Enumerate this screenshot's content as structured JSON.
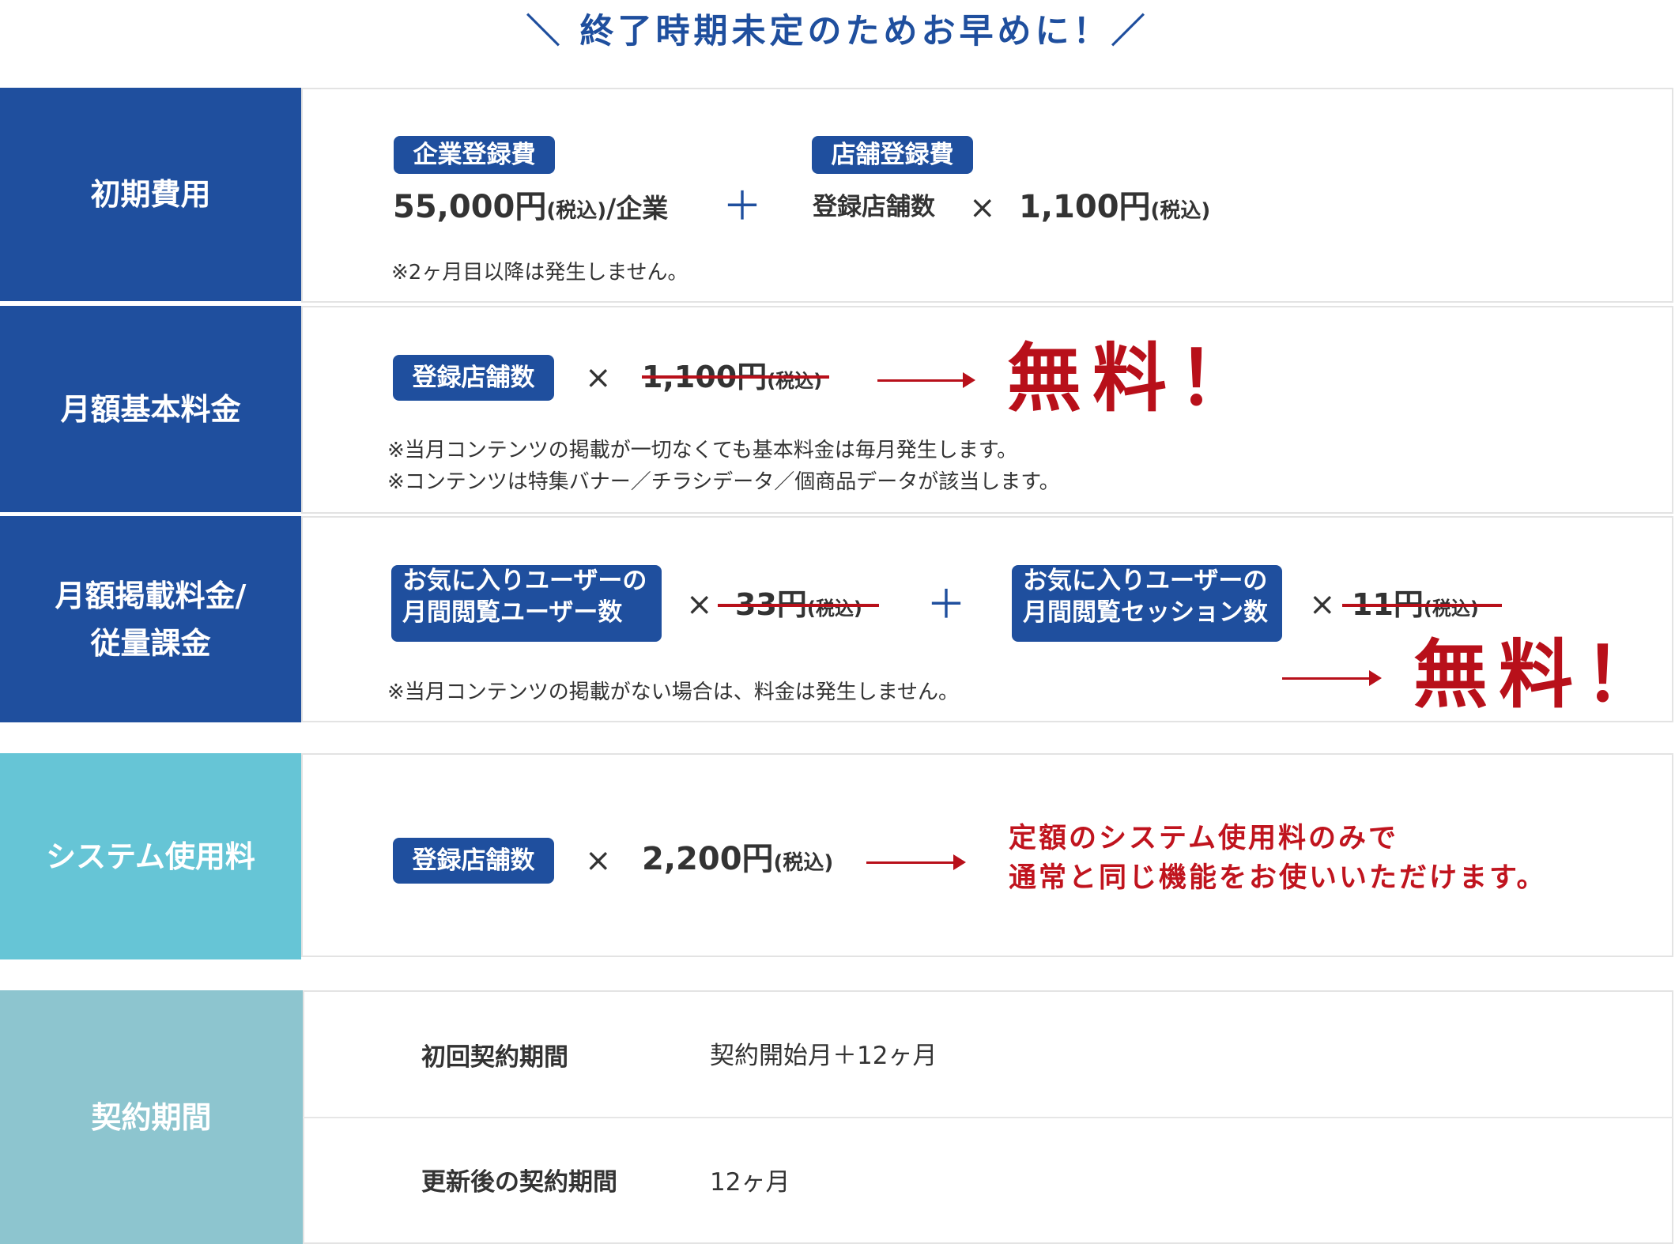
{
  "headline": "＼ 終了時期未定のためお早めに！／",
  "initial": {
    "label": "初期費用",
    "company_badge": "企業登録費",
    "company_price": "55,000円",
    "company_tax": "(税込)",
    "company_unit": "/企業",
    "plus": "＋",
    "store_badge": "店舗登録費",
    "store_count": "登録店舗数",
    "times": "×",
    "store_price": "1,100円",
    "store_tax": "(税込)",
    "note": "※2ヶ月目以降は発生しません。"
  },
  "monthly_basic": {
    "label": "月額基本料金",
    "badge": "登録店舗数",
    "times": "×",
    "old_price": "1,100円",
    "old_tax": "(税込)",
    "free": "無料！",
    "note1": "※当月コンテンツの掲載が一切なくても基本料金は毎月発生します。",
    "note2": "※コンテンツは特集バナー／チラシデータ／個商品データが該当します。"
  },
  "monthly_listing": {
    "label_line1": "月額掲載料金/",
    "label_line2": "従量課金",
    "badge1_line1": "お気に入りユーザーの",
    "badge1_line2": "月間閲覧ユーザー数",
    "times1": "×",
    "old_price1": "33円",
    "old_tax1": "(税込)",
    "plus": "＋",
    "badge2_line1": "お気に入りユーザーの",
    "badge2_line2": "月間閲覧セッション数",
    "times2": "×",
    "old_price2": "11円",
    "old_tax2": "(税込)",
    "free": "無料！",
    "note": "※当月コンテンツの掲載がない場合は、料金は発生しません。"
  },
  "system_fee": {
    "label": "システム使用料",
    "badge": "登録店舗数",
    "times": "×",
    "price": "2,200円",
    "tax": "(税込)",
    "message_line1": "定額のシステム使用料のみで",
    "message_line2": "通常と同じ機能をお使いいただけます。"
  },
  "contract": {
    "label": "契約期間",
    "rows": [
      {
        "name": "初回契約期間",
        "value": "契約開始月＋12ヶ月"
      },
      {
        "name": "更新後の契約期間",
        "value": "12ヶ月"
      }
    ]
  },
  "colors": {
    "navy": "#1f4f9e",
    "teal": "#66c5d6",
    "grayblue": "#8dc5cf",
    "red": "#b8101a"
  }
}
